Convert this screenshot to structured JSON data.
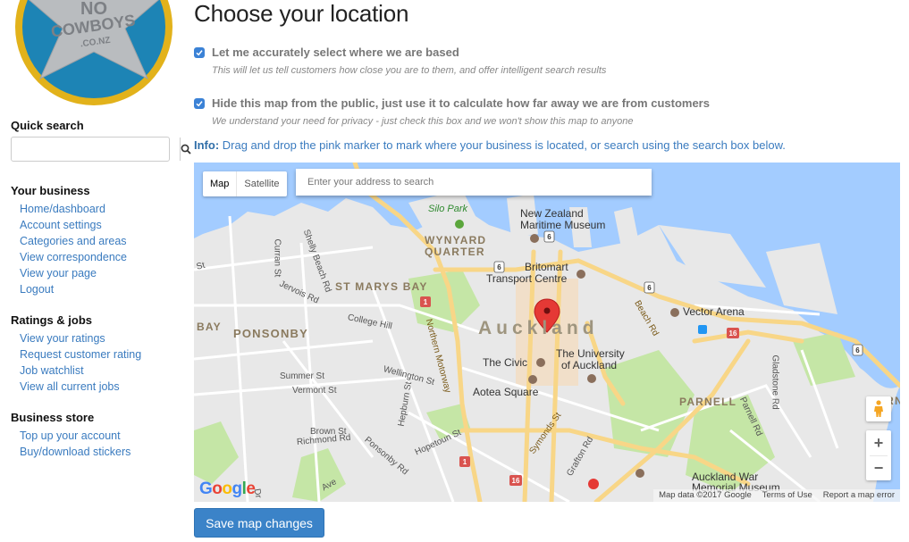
{
  "logo": {
    "line1": "NO",
    "line2": "COWBOYS",
    "line3": ".CO.NZ"
  },
  "sidebar": {
    "quick_search": {
      "title": "Quick search",
      "value": "",
      "placeholder": ""
    },
    "sections": [
      {
        "title": "Your business",
        "items": [
          "Home/dashboard",
          "Account settings",
          "Categories and areas",
          "View correspondence",
          "View your page",
          "Logout"
        ]
      },
      {
        "title": "Ratings & jobs",
        "items": [
          "View your ratings",
          "Request customer rating",
          "Job watchlist",
          "View all current jobs"
        ]
      },
      {
        "title": "Business store",
        "items": [
          "Top up your account",
          "Buy/download stickers"
        ]
      }
    ]
  },
  "main": {
    "title": "Choose your location",
    "options": [
      {
        "label": "Let me accurately select where we are based",
        "help": "This will let us tell customers how close you are to them, and offer intelligent search results",
        "checked": true
      },
      {
        "label": "Hide this map from the public, just use it to calculate how far away we are from customers",
        "help": "We understand your need for privacy - just check this box and we won't show this map to anyone",
        "checked": true
      }
    ],
    "info_label": "Info:",
    "info_text": " Drag and drop the pink marker to mark where your business is located, or search using the search box below.",
    "save_label": "Save map changes"
  },
  "map": {
    "type_buttons": [
      "Map",
      "Satellite"
    ],
    "active_type": "Map",
    "search_placeholder": "Enter your address to search",
    "search_value": "",
    "google_logo": "Google",
    "attribution": [
      "Map data ©2017 Google",
      "Terms of Use",
      "Report a map error"
    ],
    "zoom_in": "+",
    "zoom_out": "−",
    "labels": {
      "silo_park": "Silo Park",
      "nz_maritime_1": "New Zealand",
      "nz_maritime_2": "Maritime Museum",
      "wynyard_1": "WYNYARD",
      "wynyard_2": "QUARTER",
      "britomart_1": "Britomart",
      "britomart_2": "Transport Centre",
      "st_marys_bay": "ST MARYS BAY",
      "ponsonby": "PONSONBY",
      "bay": "BAY",
      "auckland": "Auckland",
      "vector_arena": "Vector Arena",
      "the_civic": "The Civic",
      "uni_1": "The University",
      "uni_2": "of Auckland",
      "aotea": "Aotea Square",
      "parnell": "PARNELL",
      "museum_1": "Auckland War",
      "museum_2": "Memorial Museum",
      "curran": "Curran St",
      "shelly": "Shelly Beach Rd",
      "jervois": "Jervois Rd",
      "college_hill": "College Hill",
      "northern_mwy": "Northern Motorway",
      "beach_rd": "Beach Rd",
      "wellington": "Wellington St",
      "summer": "Summer St",
      "vermont": "Vermont St",
      "brown": "Brown St",
      "richmond": "Richmond Rd",
      "hepburn": "Hepburn St",
      "ponsonby_rd": "Ponsonby Rd",
      "hopetoun": "Hopetoun St",
      "symonds": "Symonds St",
      "grafton": "Grafton Rd",
      "parnell_rd": "Parnell Rd",
      "gladstone": "Gladstone Rd",
      "st": "St",
      "ave": "Ave",
      "dr": "Dr"
    },
    "shields": [
      "1",
      "6",
      "16"
    ]
  }
}
